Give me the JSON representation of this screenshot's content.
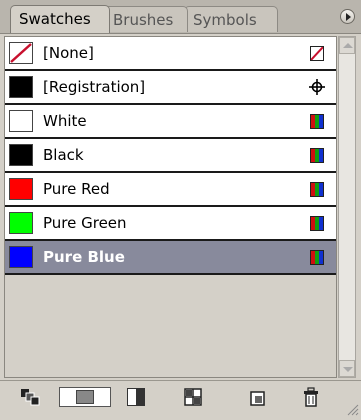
{
  "tabs": [
    {
      "label": "Swatches",
      "active": true
    },
    {
      "label": "Brushes",
      "active": false
    },
    {
      "label": "Symbols",
      "active": false
    }
  ],
  "swatches": [
    {
      "name": "[None]",
      "color": "none",
      "type": "none",
      "selected": false
    },
    {
      "name": "[Registration]",
      "color": "#000000",
      "type": "registration",
      "selected": false
    },
    {
      "name": "White",
      "color": "#ffffff",
      "type": "process",
      "selected": false
    },
    {
      "name": "Black",
      "color": "#000000",
      "type": "process",
      "selected": false
    },
    {
      "name": "Pure Red",
      "color": "#ff0000",
      "type": "process",
      "selected": false
    },
    {
      "name": "Pure Green",
      "color": "#00ff00",
      "type": "process",
      "selected": false
    },
    {
      "name": "Pure Blue",
      "color": "#0000ff",
      "type": "process",
      "selected": true
    }
  ],
  "toolbar": {
    "icons": [
      "show-swatch-kinds-icon",
      "list-view-icon",
      "small-view-icon",
      "swatch-options-icon",
      "new-swatch-icon",
      "delete-swatch-icon"
    ]
  },
  "colors": {
    "selected_row": "#888a9c",
    "panel_bg": "#d4d0c8"
  }
}
